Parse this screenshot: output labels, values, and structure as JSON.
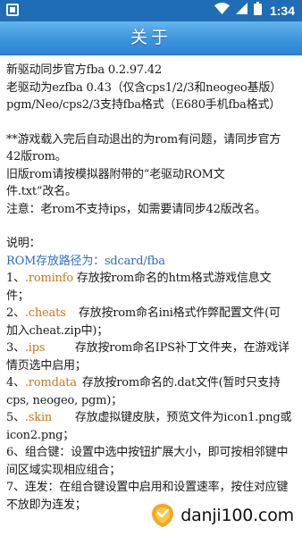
{
  "status_bar": {
    "time": "1:34",
    "icons": [
      "app-icon",
      "wifi-icon",
      "signal-icon",
      "battery-icon"
    ],
    "bg_color": "#1f6eb5"
  },
  "header": {
    "title": "关于",
    "bg_color": "#3c94dc"
  },
  "content": {
    "intro": [
      "新驱动同步官方fba 0.2.97.42",
      "老驱动为ezfba 0.43（仅含cps1/2/3和neogeo基版）",
      " pgm/Neo/cps2/3支持fba格式（E680手机fba格式）"
    ],
    "notice": [
      "**游戏载入完后自动退出的为rom有问题，请同步官方",
      "42版rom。",
      "   旧版rom请按模拟器附带的“老驱动ROM文",
      "件.txt”改名。",
      "注意：老rom不支持ips，如需要请同步42版改名。"
    ],
    "explain_label": "说明：",
    "rom_path": "ROM存放路径为：sdcard/fba",
    "items": [
      {
        "num": "1、",
        "ext": ".rominfo",
        "line1": "存放按rom命名的htm格式游戏信息文",
        "line2": "件；"
      },
      {
        "num": "2、",
        "ext": ".cheats",
        "line1": "存放按rom命名ini格式作弊配置文件(可",
        "line2": "加入cheat.zip中)；"
      },
      {
        "num": "3、",
        "ext": ".ips",
        "line1": "存放按rom命名IPS补丁文件夹，在游戏详",
        "line2": "情页选中启用；"
      },
      {
        "num": "4、",
        "ext": ".romdata",
        "line1": "存放按rom命名的.dat文件(暂时只支持",
        "line2": "cps, neogeo, pgm)；"
      },
      {
        "num": "5、",
        "ext": ".skin",
        "line1": "存放虚拟键皮肤，预览文件为icon1.png或",
        "line2": "icon2.png；"
      }
    ],
    "tail": [
      "6、组合键：设置中选中按钮扩展大小，即可按相邻键中",
      "间区域实现相应组合；",
      "7、连发：在组合键设置中启用和设置速率，按住对应键",
      "不放即为连发；"
    ],
    "path_color": "#2b6fc4",
    "ext_color": "#c87818"
  },
  "watermark": {
    "text": "danji100.com"
  }
}
